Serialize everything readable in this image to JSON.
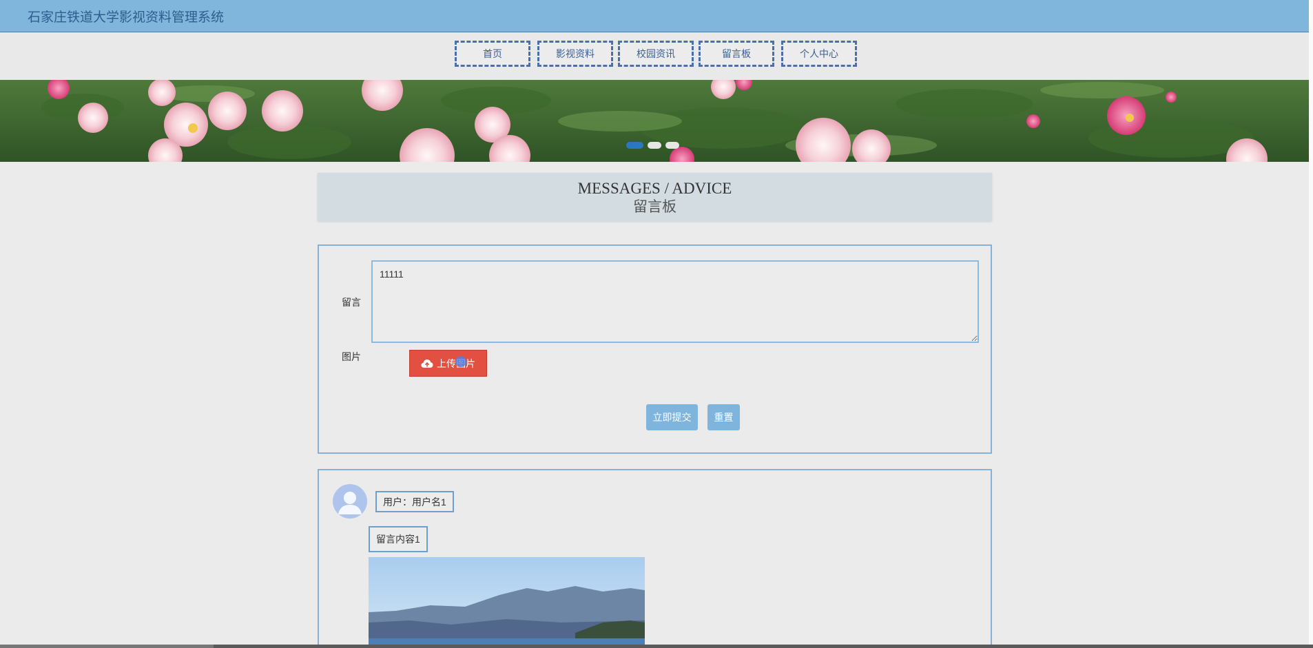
{
  "header": {
    "site_title": "石家庄铁道大学影视资料管理系统"
  },
  "nav": {
    "items": [
      {
        "label": "首页"
      },
      {
        "label": "影视资料"
      },
      {
        "label": "校园资讯"
      },
      {
        "label": "留言板"
      },
      {
        "label": "个人中心"
      }
    ]
  },
  "banner": {
    "slide_count": 3,
    "active_slide": 1
  },
  "section_title": {
    "en": "MESSAGES / ADVICE",
    "cn": "留言板"
  },
  "form": {
    "message_label": "留言",
    "message_value": "11111",
    "image_label": "图片",
    "upload_label": "上传图片",
    "submit_label": "立即提交",
    "reset_label": "重置"
  },
  "messages": [
    {
      "user": "用户：用户名1",
      "content": "留言内容1"
    }
  ],
  "colors": {
    "header_bg": "#80b6dc",
    "nav_border": "#4a6fb0",
    "upload_btn": "#e15040",
    "action_btn": "#7fb4dc",
    "panel_border": "#86b1d8"
  }
}
